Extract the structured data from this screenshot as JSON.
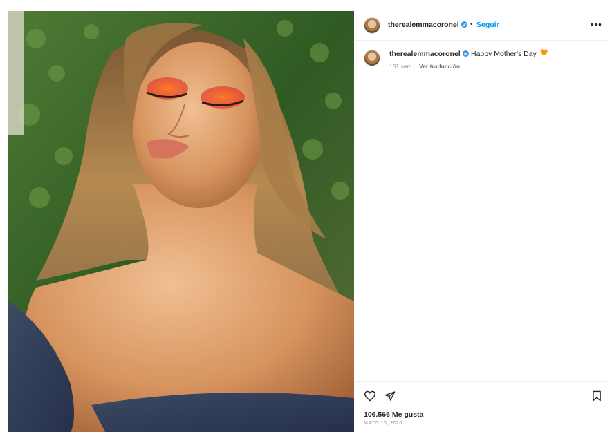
{
  "post": {
    "username": "therealemmacoronel",
    "follow_label": "Seguir",
    "separator": "•",
    "more_label": "•••",
    "caption": {
      "username": "therealemmacoronel",
      "text": "Happy Mother's Day",
      "emoji": "🧡",
      "age": "151 sem",
      "translate_label": "Ver traducción"
    },
    "likes": "106.566 Me gusta",
    "date": "MAYO 10, 2020"
  },
  "icons": {
    "like": "heart-outline-icon",
    "share": "paper-plane-icon",
    "save": "bookmark-icon",
    "verified": "verified-badge-icon"
  },
  "colors": {
    "link_blue": "#0095f6",
    "verified_blue": "#3897f0",
    "text": "#262626",
    "muted": "#8e8e8e"
  }
}
